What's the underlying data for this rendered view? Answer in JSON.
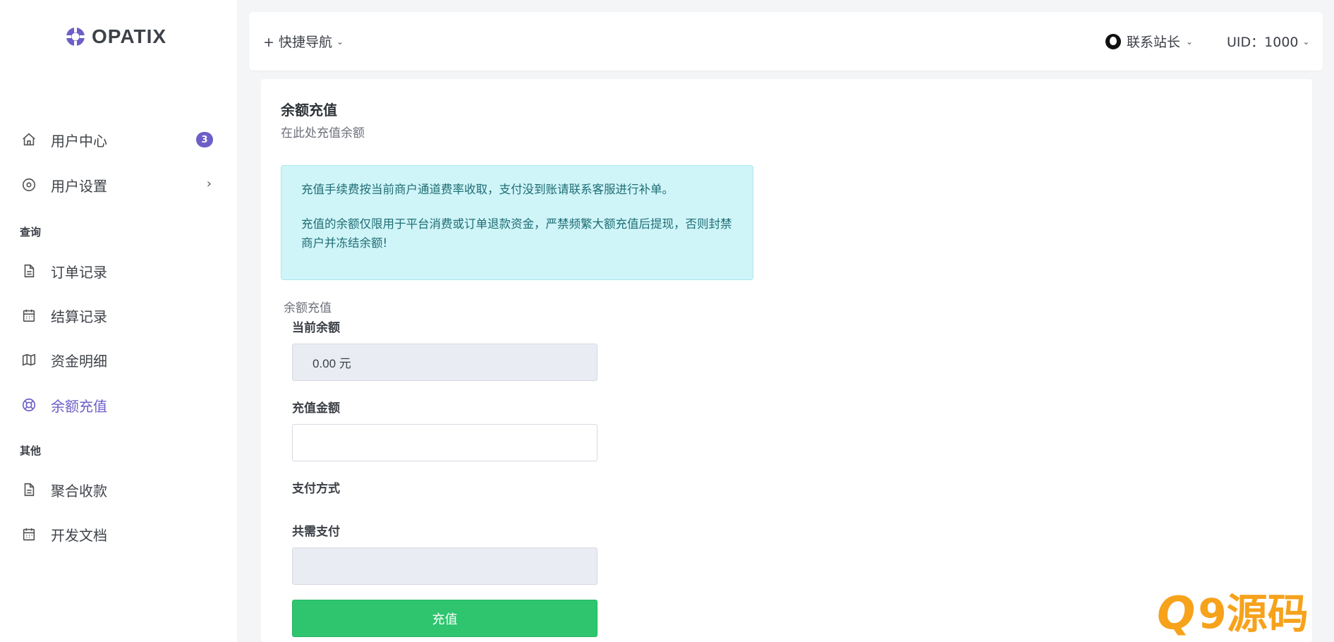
{
  "brand": {
    "name": "OPATIX"
  },
  "header": {
    "quick_nav": "+ 快捷导航",
    "contact": "联系站长",
    "uid": "UID：1000"
  },
  "sidebar": {
    "items": [
      {
        "label": "用户中心",
        "badge": "3"
      },
      {
        "label": "用户设置"
      }
    ],
    "section_query": "查询",
    "query_items": [
      {
        "label": "订单记录"
      },
      {
        "label": "结算记录"
      },
      {
        "label": "资金明细"
      },
      {
        "label": "余额充值"
      }
    ],
    "section_other": "其他",
    "other_items": [
      {
        "label": "聚合收款"
      },
      {
        "label": "开发文档"
      }
    ]
  },
  "page": {
    "title": "余额充值",
    "subtitle": "在此处充值余额",
    "notice_1": "充值手续费按当前商户通道费率收取，支付没到账请联系客服进行补单。",
    "notice_2": "充值的余额仅限用于平台消费或订单退款资金，严禁频繁大额充值后提现，否则封禁商户并冻结余额!",
    "form_legend": "余额充值",
    "current_balance_label": "当前余额",
    "current_balance_value": "0.00 元",
    "amount_label": "充值金额",
    "amount_value": "",
    "payment_method_label": "支付方式",
    "total_label": "共需支付",
    "total_value": "",
    "submit_label": "充值"
  },
  "watermark": {
    "q": "Q",
    "text": "9源码"
  },
  "colors": {
    "accent": "#6c5fc7",
    "alert_bg": "#cff5f8",
    "alert_text": "#1f6d75",
    "submit": "#2ec56e",
    "watermark": "#f7a21b"
  }
}
